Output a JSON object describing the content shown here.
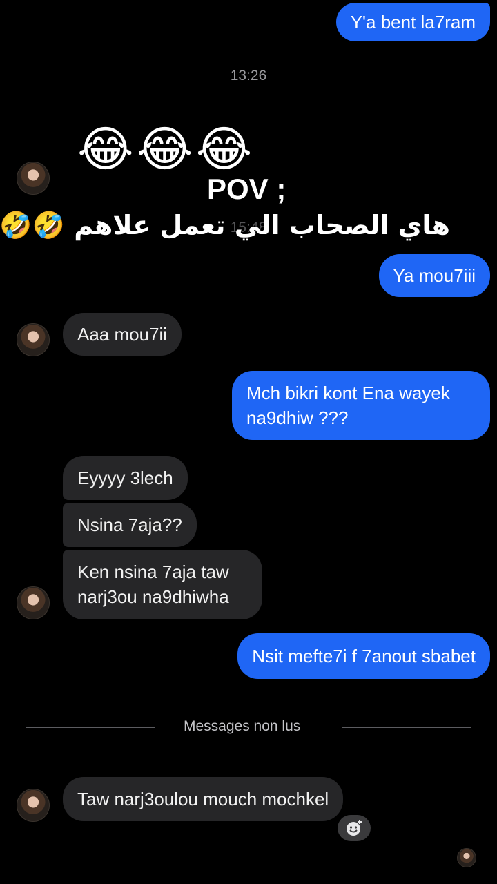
{
  "top_partial_bubble": {
    "text": "Y'a bent la7ram"
  },
  "timestamps": {
    "first": "13:26",
    "second": "15:48"
  },
  "overlay": {
    "emojis": "😂😂😂",
    "title": "POV ;",
    "arabic": "هاي الصحاب الي تعمل علاهم 🤣🤣"
  },
  "messages": {
    "out_1": "Ya mou7iii",
    "in_1": "Aaa mou7ii",
    "out_2": "Mch bikri kont Ena wayek na9dhiw ???",
    "in_2": "Eyyyy 3lech",
    "in_3": "Nsina 7aja??",
    "in_4": "Ken nsina 7aja taw narj3ou na9dhiwha",
    "out_3": "Nsit mefte7i f 7anout sbabet",
    "in_5": "Taw narj3oulou mouch mochkel"
  },
  "unread_divider": {
    "label": "Messages non lus"
  },
  "icons": {
    "avatar": "contact-avatar",
    "react": "add-reaction-icon",
    "seen": "seen-avatar"
  },
  "colors": {
    "outgoing_bubble": "#1f66f5",
    "incoming_bubble": "#262628",
    "background": "#000000"
  }
}
